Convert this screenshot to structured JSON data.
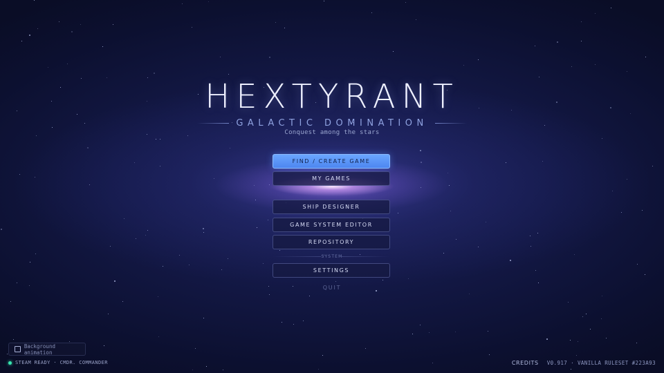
{
  "title": "HEXTYRANT",
  "subtitle": "GALACTIC DOMINATION",
  "tagline": "Conquest among the stars",
  "menu": {
    "find_create": "FIND / CREATE GAME",
    "my_games": "MY GAMES",
    "ship_designer": "SHIP DESIGNER",
    "game_system_editor": "GAME SYSTEM EDITOR",
    "repository": "REPOSITORY",
    "section_system": "SYSTEM",
    "settings": "SETTINGS",
    "quit": "QUIT"
  },
  "background_animation": {
    "label": "Background animation",
    "checked": false
  },
  "status": {
    "text": "STEAM READY · CMDR. COMMANDER",
    "indicator_color": "#37e6b0"
  },
  "footer": {
    "credits": "CREDITS",
    "version": "V0.917 · VANILLA RULESET #223A93"
  },
  "colors": {
    "primary_button": "#5a95f8",
    "background": "#0b0f2a"
  }
}
